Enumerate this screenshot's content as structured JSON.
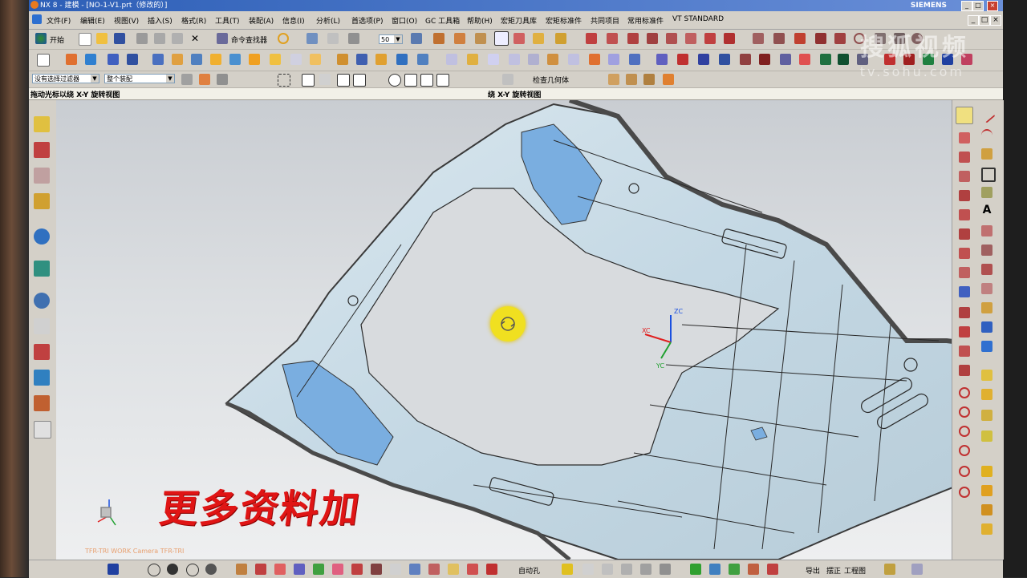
{
  "window": {
    "title": "NX 8 - 建模 - [NO-1-V1.prt（修改的）]",
    "brand": "SIEMENS",
    "controls": [
      "_",
      "□",
      "×"
    ]
  },
  "menu": [
    "文件(F)",
    "编辑(E)",
    "视图(V)",
    "插入(S)",
    "格式(R)",
    "工具(T)",
    "装配(A)",
    "信息(I)",
    "分析(L)",
    "首选项(P)",
    "窗口(O)",
    "GC 工具箱",
    "帮助(H)",
    "宏矩刀具库",
    "宏矩标准件",
    "共同项目",
    "常用标准件",
    "VT STANDARD"
  ],
  "toolbar": {
    "start_label": "开始",
    "command_finder": "命令查找器",
    "zoom_value": "50",
    "filter_value": "没有选择过滤器",
    "assembly_value": "整个装配",
    "check_geometry": "检查几何体"
  },
  "status": {
    "left": "拖动光标以绕 X-Y 旋转视图",
    "center": "绕 X-Y 旋转视图"
  },
  "viewport": {
    "label": "TFR-TRI WORK Camera TFR-TRI",
    "watermark": "更多资料加",
    "sohu": "搜狐视频",
    "sohu_url": "tv.sohu.com",
    "axis_z": "ZC",
    "axis_x": "XC",
    "axis_y": "YC"
  },
  "bottom": {
    "items": [
      "导出",
      "摆正",
      "工程图"
    ],
    "auto_hole": "自动孔"
  },
  "colors": {
    "titlebar": "#2d5fb7",
    "part": "#c6dbe6",
    "part_edge": "#3a3a3a",
    "watermark": "#e01515",
    "cursor": "#f0e020"
  }
}
